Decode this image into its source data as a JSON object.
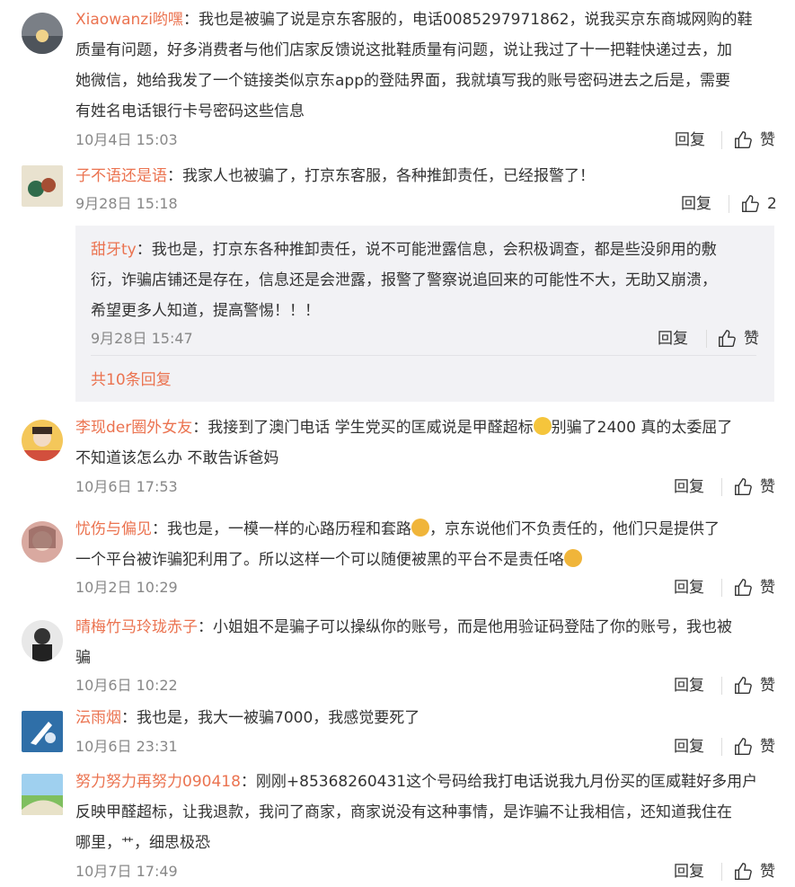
{
  "comments": [
    {
      "user": "Xiaowanzi哟嘿",
      "text_lines": [
        "我也是被骗了说是京东客服的，电话0085297971862，说我买京东商城网购的鞋",
        "质量有问题，好多消费者与他们店家反馈说这批鞋质量有问题，说让我过了十一把鞋快递过去，加",
        "她微信，她给我发了一个链接类似京东app的登陆界面，我就填写我的账号密码进去之后是，需要",
        "有姓名电话银行卡号密码这些信息"
      ],
      "time": "10月4日 15:03",
      "reply": "回复",
      "like": "赞"
    },
    {
      "user": "子不语还是语",
      "text_lines": [
        "我家人也被骗了，打京东客服，各种推卸责任，已经报警了！"
      ],
      "time": "9月28日 15:18",
      "reply": "回复",
      "like": "2"
    },
    {
      "user": "甜牙ty",
      "text_lines": [
        "我也是，打京东各种推卸责任，说不可能泄露信息，会积极调查，都是些没卵用的敷",
        "衍，诈骗店铺还是存在，信息还是会泄露，报警了警察说追回来的可能性不大，无助又崩溃，",
        "希望更多人知道，提高警惕！！！"
      ],
      "time": "9月28日 15:47",
      "reply": "回复",
      "like": "赞",
      "more_replies": "共10条回复"
    },
    {
      "user": "李现der圈外女友",
      "text_lines": [
        "我接到了澳门电话 学生党买的匡威说是甲醛超标",
        "别骗了2400 真的太委屈了",
        "不知道该怎么办 不敢告诉爸妈"
      ],
      "time": "10月6日 17:53",
      "reply": "回复",
      "like": "赞"
    },
    {
      "user": "忧伤与偏见",
      "text_lines": [
        "我也是，一模一样的心路历程和套路",
        "，京东说他们不负责任的，他们只是提供了",
        "一个平台被诈骗犯利用了。所以这样一个可以随便被黑的平台不是责任咯"
      ],
      "time": "10月2日 10:29",
      "reply": "回复",
      "like": "赞"
    },
    {
      "user": "晴梅竹马玲珑赤子",
      "text_lines": [
        "小姐姐不是骗子可以操纵你的账号，而是他用验证码登陆了你的账号，我也被",
        "骗"
      ],
      "time": "10月6日 10:22",
      "reply": "回复",
      "like": "赞"
    },
    {
      "user": "沄雨烟",
      "text_lines": [
        "我也是，我大一被骗7000，我感觉要死了"
      ],
      "time": "10月6日 23:31",
      "reply": "回复",
      "like": "赞"
    },
    {
      "user": "努力努力再努力090418",
      "text_lines": [
        "刚刚+85368260431这个号码给我打电话说我九月份买的匡威鞋好多用户",
        "反映甲醛超标，让我退款，我问了商家，商家说没有这种事情，是诈骗不让我相信，还知道我住在",
        "哪里，",
        "，细思极恐"
      ],
      "time": "10月7日 17:49",
      "reply": "回复",
      "like": "赞"
    }
  ],
  "colors": {
    "username": "#eb7350",
    "sub_bg": "#f2f2f5",
    "meta": "#888888"
  }
}
